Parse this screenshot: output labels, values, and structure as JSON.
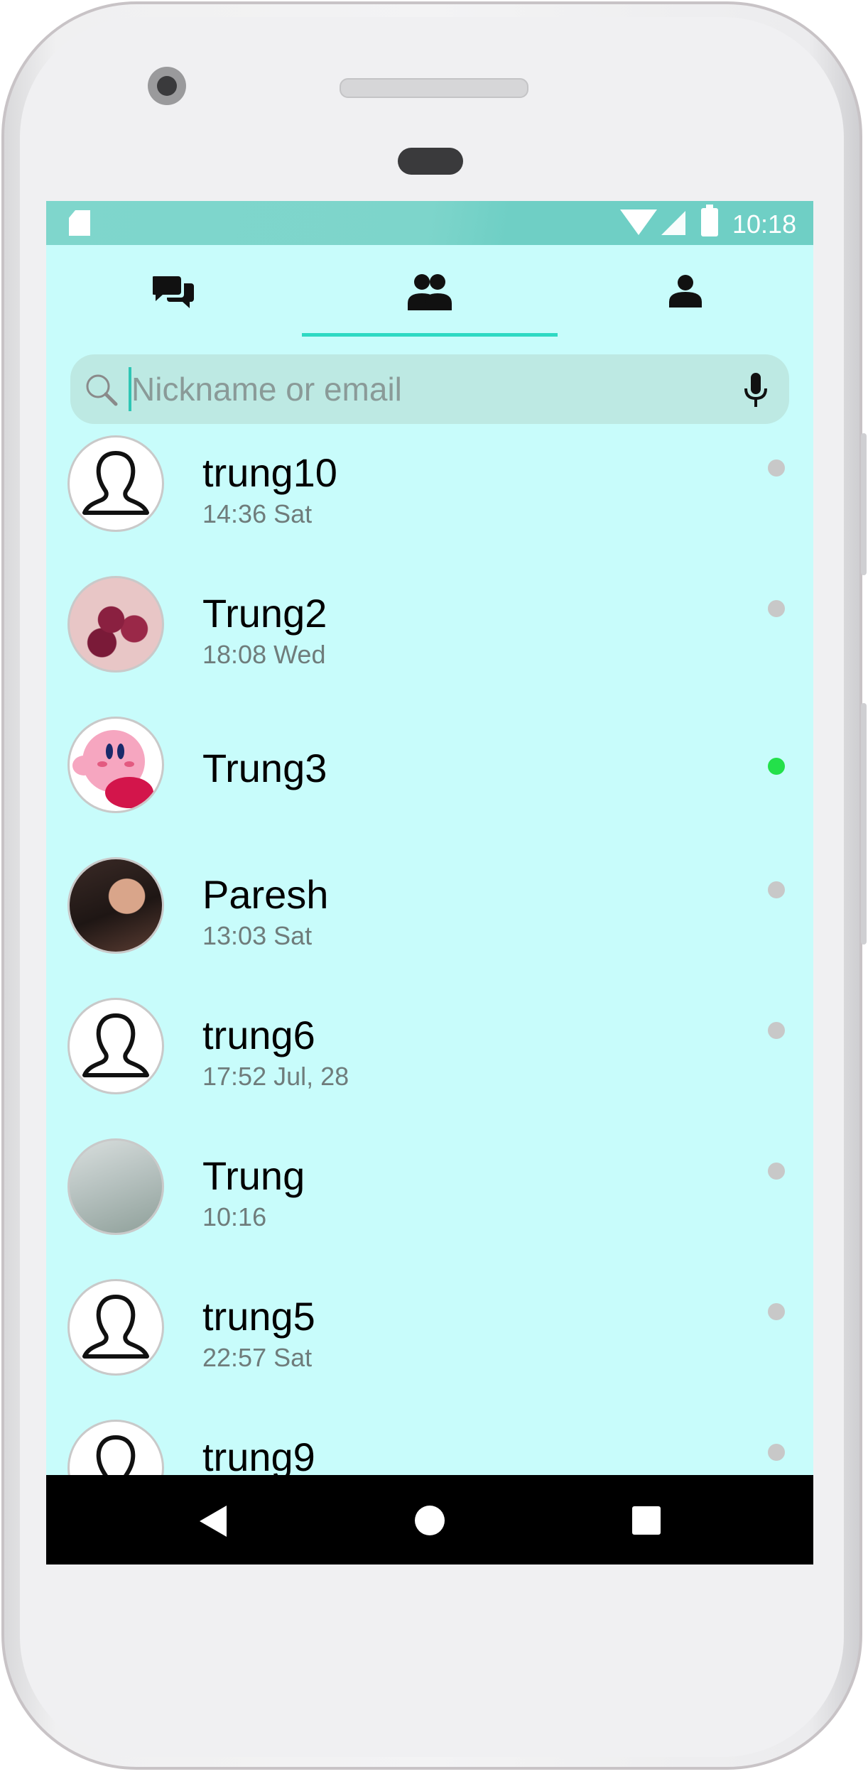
{
  "status_bar": {
    "time": "10:18"
  },
  "tabs": [
    {
      "icon": "chats-icon",
      "selected": false
    },
    {
      "icon": "friends-icon",
      "selected": true
    },
    {
      "icon": "profile-icon",
      "selected": false
    }
  ],
  "search": {
    "placeholder": "Nickname or email",
    "value": ""
  },
  "contacts": [
    {
      "name": "trung10",
      "time": "14:36 Sat",
      "avatar": "default-avatar",
      "online": false
    },
    {
      "name": "Trung2",
      "time": "18:08 Wed",
      "avatar": "photo-avatar",
      "online": false
    },
    {
      "name": "Trung3",
      "time": "",
      "avatar": "photo-avatar",
      "online": true
    },
    {
      "name": "Paresh",
      "time": "13:03 Sat",
      "avatar": "photo-avatar",
      "online": false
    },
    {
      "name": "trung6",
      "time": "17:52 Jul, 28",
      "avatar": "default-avatar",
      "online": false
    },
    {
      "name": "Trung",
      "time": "10:16",
      "avatar": "photo-avatar",
      "online": false
    },
    {
      "name": "trung5",
      "time": "22:57 Sat",
      "avatar": "default-avatar",
      "online": false
    },
    {
      "name": "trung9",
      "time": "",
      "avatar": "default-avatar",
      "online": false
    }
  ],
  "colors": {
    "screen_bg": "#c8fcfb",
    "accent": "#2ed9c3",
    "online": "#23e04a",
    "offline": "#c8c8c8",
    "status_bar": "#7dd5cb"
  }
}
